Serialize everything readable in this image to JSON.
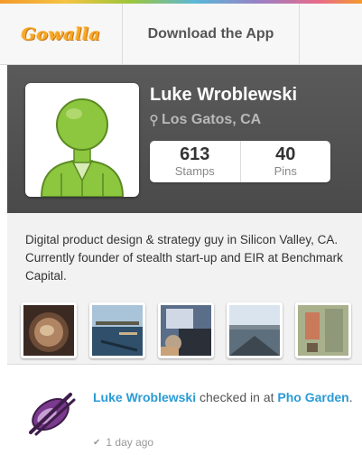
{
  "header": {
    "logo_text": "Gowalla",
    "download_label": "Download the App"
  },
  "profile": {
    "name": "Luke Wroblewski",
    "location": "Los Gatos, CA",
    "stats": [
      {
        "value": "613",
        "label": "Stamps"
      },
      {
        "value": "40",
        "label": "Pins"
      }
    ]
  },
  "bio": "Digital product design & strategy guy in Silicon Valley, CA. Currently founder of stealth start-up and EIR at Benchmark Capital.",
  "photos": [
    {
      "name": "photo-coffee"
    },
    {
      "name": "photo-harbor"
    },
    {
      "name": "photo-car-interior"
    },
    {
      "name": "photo-pier"
    },
    {
      "name": "photo-room"
    }
  ],
  "activity": {
    "user": "Luke Wroblewski",
    "action": " checked in at ",
    "place": "Pho Garden",
    "end": ".",
    "time": "1 day ago"
  },
  "colors": {
    "logo": "#f6a823",
    "link": "#2a9bd6",
    "profile_bg": "#4f4f4f",
    "avatar_green": "#8dc63f"
  }
}
